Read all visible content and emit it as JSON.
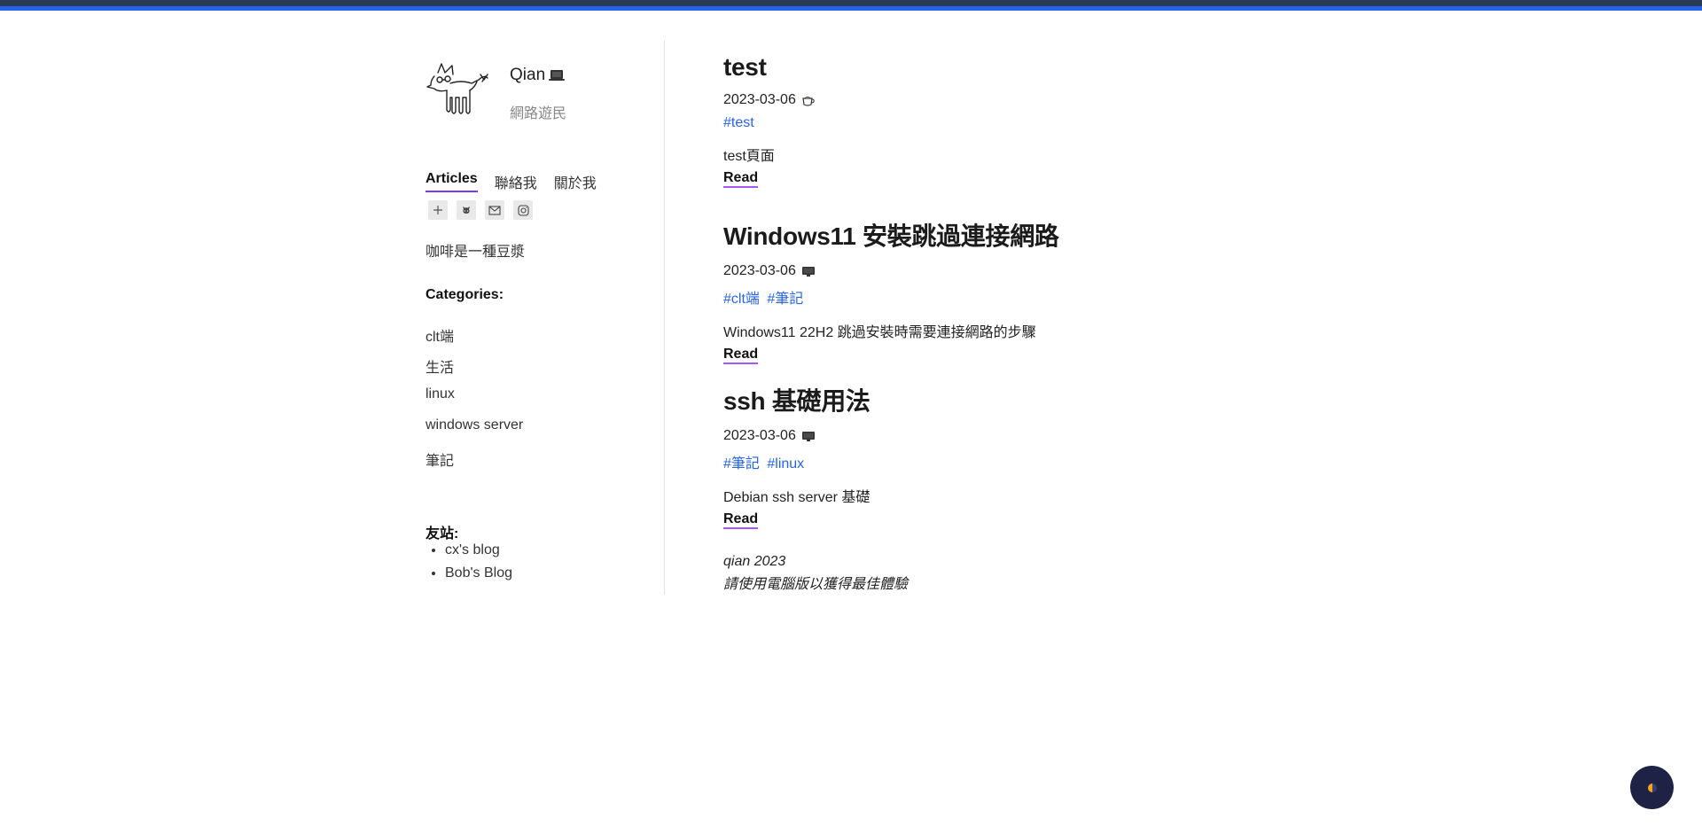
{
  "colors": {
    "accent": "#2563eb",
    "underline": "#a855f7",
    "fab_bg": "#1e2245",
    "top_bar_dark": "#2b3a55"
  },
  "profile": {
    "name": "Qian",
    "name_icon": "laptop-icon",
    "subtitle": "網路遊民",
    "avatar_icon": "cat-sketch-icon"
  },
  "nav": {
    "tabs": [
      {
        "label": "Articles",
        "active": true
      },
      {
        "label": "聯絡我"
      },
      {
        "label": "關於我"
      }
    ]
  },
  "social_icons": [
    "plus-icon",
    "github-icon",
    "mail-icon",
    "instagram-icon"
  ],
  "tagline": "咖啡是一種豆漿",
  "categories": {
    "title": "Categories:",
    "items": [
      "clt端",
      "生活",
      "linux",
      "windows server",
      "筆記"
    ]
  },
  "friends": {
    "title": "友站:",
    "items": [
      "cx's blog",
      "Bob's Blog"
    ]
  },
  "posts": [
    {
      "title": "test",
      "date": "2023-03-06",
      "date_icon": "coffee-icon",
      "tags": [
        "#test"
      ],
      "description": "test頁面",
      "read_label": "Read"
    },
    {
      "title": "Windows11 安裝跳過連接網路",
      "date": "2023-03-06",
      "date_icon": "monitor-icon",
      "tags": [
        "#clt端",
        "#筆記"
      ],
      "description": "Windows11 22H2 跳過安裝時需要連接網路的步驟",
      "read_label": "Read"
    },
    {
      "title": "ssh 基礎用法",
      "date": "2023-03-06",
      "date_icon": "monitor-icon",
      "tags": [
        "#筆記",
        "#linux"
      ],
      "description": "Debian ssh server 基礎",
      "read_label": "Read"
    }
  ],
  "footer": {
    "line1": "qian 2023",
    "line2": "請使用電腦版以獲得最佳體驗"
  },
  "theme_toggle": {
    "icon": "theme-toggle-icon"
  }
}
